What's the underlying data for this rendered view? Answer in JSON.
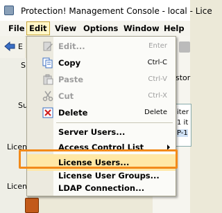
{
  "window": {
    "title": "Protection! Management Console - local - Lice"
  },
  "menubar": {
    "items": [
      "File",
      "Edit",
      "View",
      "Options",
      "Window",
      "Help"
    ]
  },
  "background": {
    "fragments": [
      "E",
      "S",
      "Su",
      "Licen",
      "Licen",
      "stor",
      "iter",
      "1 it",
      "P-1"
    ]
  },
  "edit_menu": {
    "items": [
      {
        "label": "Edit...",
        "shortcut": "Enter"
      },
      {
        "label": "Copy",
        "shortcut": "Ctrl-C"
      },
      {
        "label": "Paste",
        "shortcut": "Ctrl-V"
      },
      {
        "label": "Cut",
        "shortcut": "Ctrl-X"
      },
      {
        "label": "Delete",
        "shortcut": "Delete"
      },
      {
        "label": "Server Users..."
      },
      {
        "label": "Access Control List"
      },
      {
        "label": "License Users..."
      },
      {
        "label": "License User Groups..."
      },
      {
        "label": "LDAP Connection..."
      }
    ]
  },
  "colors": {
    "highlight": "#ffe8a6",
    "focus_border": "#f28a1a",
    "disabled_text": "#9e9e9e"
  }
}
